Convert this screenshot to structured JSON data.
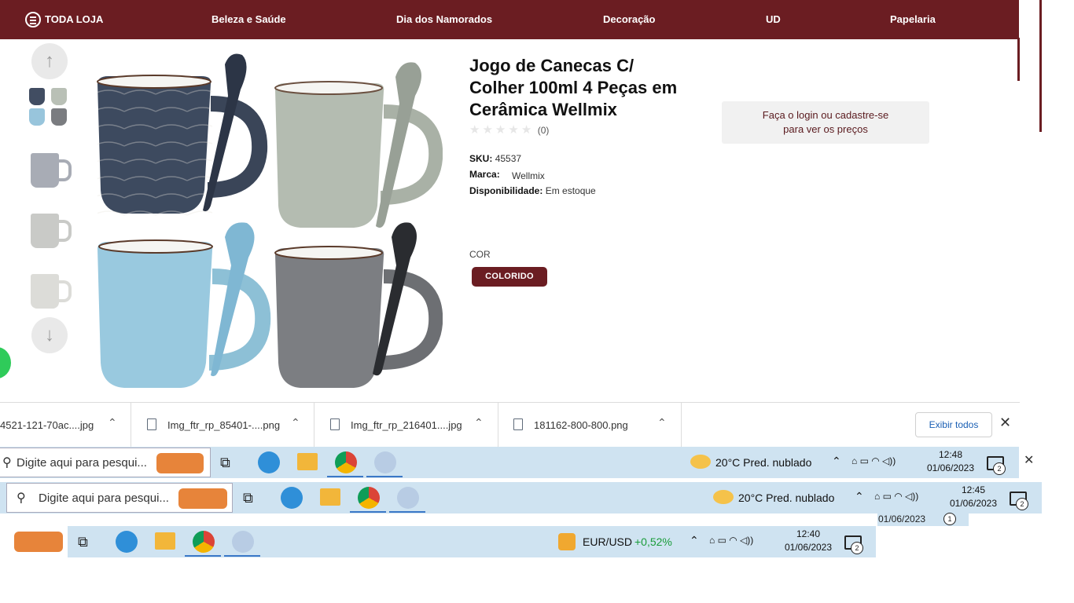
{
  "nav": {
    "all_store": "TODA LOJA",
    "items": [
      "Beleza e Saúde",
      "Dia dos Namorados",
      "Decoração",
      "UD",
      "Papelaria"
    ]
  },
  "product": {
    "title": "Jogo de Canecas C/ Colher 100ml 4 Peças em Cerâmica Wellmix",
    "rating_count": "(0)",
    "rating": 0,
    "sku_label": "SKU:",
    "sku": "45537",
    "brand_label": "Marca:",
    "brand": "Wellmix",
    "availability_label": "Disponibilidade:",
    "availability": "Em estoque",
    "color_label": "COR",
    "color_option": "COLORIDO",
    "login_prompt_line1": "Faça o login ou cadastre-se",
    "login_prompt_line2": "para ver os preços"
  },
  "downloads": {
    "items": [
      {
        "name": "4521-121-70ac....jpg"
      },
      {
        "name": "Img_ftr_rp_85401-....png"
      },
      {
        "name": "Img_ftr_rp_216401....jpg"
      },
      {
        "name": "181162-800-800.png"
      }
    ],
    "show_all": "Exibir todos"
  },
  "taskbar1": {
    "search_placeholder": "Digite aqui para pesqui...",
    "weather": "20°C  Pred. nublado",
    "time": "12:48",
    "date": "01/06/2023",
    "notifications": "2"
  },
  "taskbar2": {
    "search_placeholder": "Digite aqui para pesqui...",
    "weather": "20°C  Pred. nublado",
    "time": "12:45",
    "date": "01/06/2023",
    "notifications": "2",
    "partial_date": "01/06/2023",
    "partial_badge": "1"
  },
  "taskbar3": {
    "ticker": "EUR/USD",
    "ticker_change": "+0,52%",
    "time": "12:40",
    "date": "01/06/2023",
    "notifications": "2"
  },
  "colors": {
    "brand": "#6b1d22",
    "taskbar": "#cfe3f1",
    "positive": "#1a9c3a"
  }
}
